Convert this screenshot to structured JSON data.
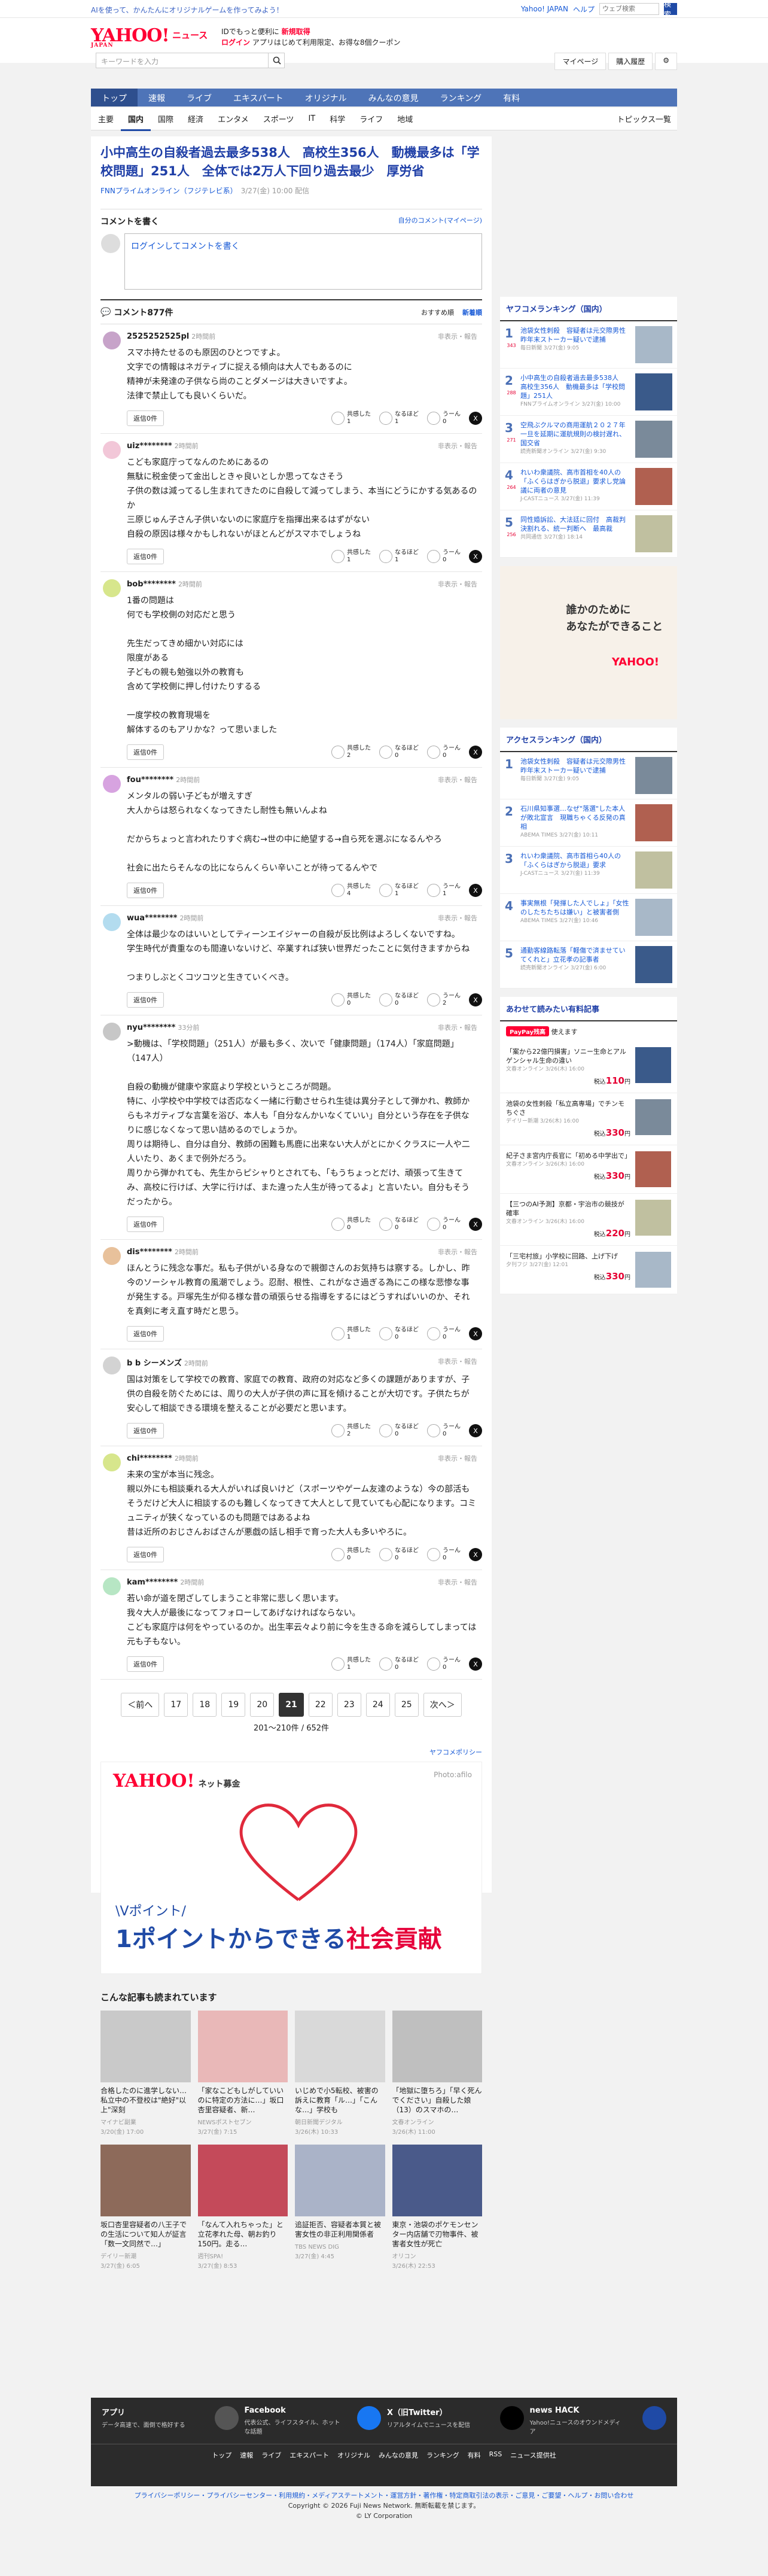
{
  "topstrip": {
    "promo": "AIを使って、かんたんにオリジナルゲームを作ってみよう！",
    "links": [
      "Yahoo! JAPAN",
      "ヘルプ"
    ],
    "search_placeholder": "ウェブ検索",
    "search_button": "検索"
  },
  "header": {
    "logo": "YAHOO!",
    "logo_sub": "JAPAN",
    "news": "ニュース",
    "promo_line1": "IDでもっと便利に",
    "promo_line1_b": "新規取得",
    "promo_line2_b": "ログイン",
    "promo_line2": "アプリはじめて利用限定、お得な8個クーポン",
    "search_placeholder": "キーワードを入力",
    "acct": [
      "マイページ",
      "購入履歴"
    ]
  },
  "gnav": [
    "トップ",
    "速報",
    "ライブ",
    "エキスパート",
    "オリジナル",
    "みんなの意見",
    "ランキング",
    "有料"
  ],
  "subnav": [
    "主要",
    "国内",
    "国際",
    "経済",
    "エンタメ",
    "スポーツ",
    "IT",
    "科学",
    "ライフ",
    "地域"
  ],
  "subnav_right": "トピックス一覧",
  "article": {
    "title": "小中高生の自殺者過去最多538人　高校生356人　動機最多は「学校問題」251人　全体では2万人下回り過去最少　厚労省",
    "source": "FNNプライムオンライン（フジテレビ系）",
    "date": "3/27(金) 10:00 配信"
  },
  "comment_box": {
    "heading": "コメントを書く",
    "mylink": "自分のコメント(マイページ)",
    "prompt": "ログインしてコメントを書く"
  },
  "comments_header": {
    "title": "コメント877件",
    "sort1": "おすすめ順",
    "sort2": "新着順"
  },
  "labels": {
    "report": "非表示・報告",
    "reply": "返信0件",
    "v1": "共感した",
    "v2": "なるほど",
    "v3": "うーん",
    "x": "X"
  },
  "comments": [
    {
      "user": "2525252525pl",
      "time": "2時間前",
      "text": "スマホ持たせるのも原因のひとつですよ。\n文字での情報はネガティブに捉える傾向は大人でもあるのに\n精神が未発達の子供なら尚のことダメージは大きいですよ。\n法律で禁止しても良いくらいだ。",
      "v": [
        "1",
        "1",
        "0"
      ],
      "color": "#c7a3c9"
    },
    {
      "user": "uiz********",
      "time": "2時間前",
      "text": "こども家庭庁ってなんのためにあるの\n無駄に税金使って金出しときゃ良いとしか思ってなさそう\n子供の数は減ってるし生まれてきたのに自殺して減ってしまう、本当にどうにかする気あるのか\n三原じゅん子さん子供いないのに家庭庁を指揮出来るはずがない\n自殺の原因は様々かもしれないがほとんどがスマホでしょうね",
      "v": [
        "1",
        "1",
        "0"
      ],
      "color": "#f2c7d8"
    },
    {
      "user": "bob********",
      "time": "2時間前",
      "text": "1番の問題は\n何でも学校側の対応だと思う\n\n先生だってきめ細かい対応には\n限度がある\n子どもの親も勉強以外の教育も\n含めて学校側に押し付けたりするる\n\n一度学校の教育現場を\n解体するのもアリかな？って思いました",
      "v": [
        "2",
        "0",
        "0"
      ],
      "color": "#d7e68c"
    },
    {
      "user": "fou********",
      "time": "2時間前",
      "text": "メンタルの弱い子どもが増えすぎ\n大人からは怒られなくなってきたし耐性も無いんよね\n\nだからちょっと言われたりすぐ病む→世の中に絶望する→自ら死を選ぶになるんやろ\n\n社会に出たらそんなの比にならんくらい辛いことが待ってるんやで",
      "v": [
        "4",
        "1",
        "1"
      ],
      "color": "#d7a3e0"
    },
    {
      "user": "wua********",
      "time": "2時間前",
      "text": "全体は最少なのはいいとしてティーンエイジャーの自殺が反比例はよろしくないですね。\n学生時代が貴重なのも間違いないけど、卒業すれば狭い世界だったことに気付きますからね\n\nつまりしぶとくコツコツと生きていくべき。",
      "v": [
        "0",
        "0",
        "2"
      ],
      "color": "#b3dcef"
    },
    {
      "user": "nyu********",
      "time": "33分前",
      "text": ">動機は、「学校問題」（251人）が最も多く、次いで「健康問題」（174人）「家庭問題」（147人）\n\n自殺の動機が健康や家庭より学校というところが問題。\n特に、小学校や中学校では否応なく一緒に行動させられ生徒は異分子として弾かれ、教師からもネガティブな言葉を浴び、本人も「自分なんかいなくていい」自分という存在を子供なりに感じなくなって思い詰めるのでしょうか。\n周りは期待し、自分は自分、教師の困難も馬鹿に出来ない大人がとにかくクラスに一人や二人いたり、あくまで例外だろう。\n周りから弾かれても、先生からピシャりとされても、「もうちょっとだけ、頑張って生きてみ、高校に行けば、大学に行けば、また違った人生が待ってるよ」と言いたい。自分もそうだったから。",
      "v": [
        "0",
        "0",
        "0"
      ],
      "color": "#c7c7c7"
    },
    {
      "user": "dis********",
      "time": "2時間前",
      "text": "ほんとうに残念な事だ。私も子供がいる身なので親御さんのお気持ちは察する。しかし、昨今のソーシャル教育の風潮でしょう。忍耐、根性、これがなさ過ぎる為にこの様な悲惨な事が発生する。戸塚先生が仰る様な昔の頑張らせる指導をするにはどうすればいいのか、それを真剣に考え直す時だと思う。",
      "v": [
        "1",
        "0",
        "0"
      ],
      "color": "#e8c19b"
    },
    {
      "user": "b b シーメンズ",
      "time": "2時間前",
      "text": "国は対策をして学校での教育、家庭での教育、政府の対応など多くの課題がありますが、子供の自殺を防ぐためには、周りの大人が子供の声に耳を傾けることが大切です。子供たちが安心して相談できる環境を整えることが必要だと思います。",
      "v": [
        "2",
        "0",
        "0"
      ],
      "color": "#d3d3d3"
    },
    {
      "user": "chi********",
      "time": "2時間前",
      "text": "未来の宝が本当に残念。\n親以外にも相談乗れる大人がいれば良いけど（スポーツやゲーム友達のような）今の部活もそうだけど大人に相談するのも難しくなってきて大人として見ていても心配になります。コミュニティが狭くなっているのも問題ではあるよね\n昔は近所のおじさんおばさんが悪戯の話し相手で育った大人も多いやろに。",
      "v": [
        "0",
        "0",
        "0"
      ],
      "color": "#d7e68c"
    },
    {
      "user": "kam********",
      "time": "2時間前",
      "text": "若い命が道を閉ざしてしまうこと非常に悲しく思います。\n我々大人が最後になってフォローしてあげなければならない。\nこども家庭庁は何をやっているのか。出生率云々より前に今を生きる命を減らしてしまっては元も子もない。",
      "v": [
        "1",
        "0",
        "0"
      ],
      "color": "#b7e6c4"
    }
  ],
  "pager": {
    "prev": "＜前へ",
    "pages": [
      "17",
      "18",
      "19",
      "20",
      "21",
      "22",
      "23",
      "24",
      "25"
    ],
    "current": "21",
    "next": "次へ＞",
    "info": "201〜210件 / 652件"
  },
  "yd_policy": "ヤフコメポリシー",
  "bigad": {
    "logo": "YAHOO!",
    "logo_sub": "ネット募金",
    "photo": "Photo:afilo",
    "t1": "\\Vポイント/",
    "t2a": "1ポイントからできる",
    "t2b": "社会貢献"
  },
  "related": {
    "heading": "こんな記事も読まれています",
    "items": [
      {
        "title": "合格したのに進学しない…私立中の不登校は\"絶好\"以上\"深刻",
        "src": "マイナビ副業",
        "time": "3/20(金) 17:00"
      },
      {
        "title": "「家なこどもしがしていいのに特定の方法に…」坂口杏里容疑者、新…",
        "src": "NEWSポストセブン",
        "time": "3/27(金) 7:15"
      },
      {
        "title": "いじめで小5転校、被害の訴えに教育「ル…」「こんな…」学校も",
        "src": "朝日新聞デジタル",
        "time": "3/26(木) 10:33"
      },
      {
        "title": "「地獄に堕ちろ」「早く死んでください」自殺した娘（13）のスマホの…",
        "src": "文春オンライン",
        "time": "3/26(木) 11:00"
      },
      {
        "title": "坂口杏里容疑者の八王子での生活について知人が証言「数一文同然で…」",
        "src": "デイリー新潮",
        "time": "3/27(金) 6:05"
      },
      {
        "title": "「なんて入れちゃった」と立花孝れた母、朝お釣り150円。走る…",
        "src": "週刊SPA!",
        "time": "3/27(金) 8:53"
      },
      {
        "title": "追証拒否、容疑者本質と被害女性の非正利用関係者",
        "src": "TBS NEWS DIG",
        "time": "3/27(金) 4:45"
      },
      {
        "title": "東京・池袋のポケモンセンター内店舗で刃物事件、被害者女性が死亡",
        "src": "オリコン",
        "time": "3/26(木) 22:53"
      }
    ]
  },
  "ranking": {
    "heading": "ヤフコメランキング（国内）",
    "items": [
      {
        "n": "1",
        "c": "343",
        "title": "池袋女性刺殺　容疑者は元交際男性　昨年末ストーカー疑いで逮捕",
        "src": "毎日新聞",
        "time": "3/27(金) 9:05"
      },
      {
        "n": "2",
        "c": "288",
        "title": "小中高生の自殺者過去最多538人　高校生356人　動機最多は「学校問題」251人",
        "src": "FNNプライムオンライン",
        "time": "3/27(金) 10:00"
      },
      {
        "n": "3",
        "c": "271",
        "title": "空飛ぶクルマの商用運航２０２７年一旦を延期に運航規則の検討遅れ、国交省",
        "src": "読売新聞オンライン",
        "time": "3/27(金) 9:30"
      },
      {
        "n": "4",
        "c": "264",
        "title": "れいわ衆議院、高市首相を40人の「ふくらはぎから脱退」要求し党論議に両者の意見",
        "src": "J-CASTニュース",
        "time": "3/27(金) 11:39"
      },
      {
        "n": "5",
        "c": "256",
        "title": "同性婚訴訟、大法廷に回付　高裁判決割れる、統一判断へ　最高裁",
        "src": "共同通信",
        "time": "3/27(金) 18:14"
      }
    ]
  },
  "side_ad": {
    "l1": "誰かのために",
    "l2": "あなたができること",
    "brand": "YAHOO!"
  },
  "access": {
    "heading": "アクセスランキング（国内）",
    "items": [
      {
        "n": "1",
        "title": "池袋女性刺殺　容疑者は元交際男性　昨年末ストーカー疑いで逮捕",
        "src": "毎日新聞",
        "time": "3/27(金) 9:05"
      },
      {
        "n": "2",
        "title": "石川県知事選…なぜ\"落選\"した本人が敗北宣言　現職ちゃくる反発の真相",
        "src": "ABEMA TIMES",
        "time": "3/27(金) 10:11"
      },
      {
        "n": "3",
        "title": "れいわ衆議院、高市首相ら40人の「ふくらはぎから脱退」要求",
        "src": "J-CASTニュース",
        "time": "3/27(金) 11:39"
      },
      {
        "n": "4",
        "title": "事実無根「発揮した人でしょ」「女性のしたちたちは嫌い」と被害者側",
        "src": "ABEMA TIMES",
        "time": "3/27(金) 10:46"
      },
      {
        "n": "5",
        "title": "通勤客線路転落「軽傷で済ませていてくれと」立花孝の記事者",
        "src": "読売新聞オンライン",
        "time": "3/27(金) 6:00"
      }
    ]
  },
  "paypay": {
    "heading": "あわせて読みたい有料記事",
    "label": "PayPay残高",
    "suffix": "使えます",
    "items": [
      {
        "title": "「案から22億円損害」ソニー生命とアルゲンシャル生命の違い",
        "src": "文春オンライン",
        "time": "3/26(木) 16:00",
        "price": "110"
      },
      {
        "title": "池袋の女性刺殺「私立高専場」でチンモちぐさ",
        "src": "デイリー新潮",
        "time": "3/26(木) 16:00",
        "price": "330"
      },
      {
        "title": "紀子さま宮内庁長官に「初める中学出で」",
        "src": "文春オンライン",
        "time": "3/26(木) 16:00",
        "price": "330"
      },
      {
        "title": "【三つのAI予測】京都・宇治市の競技が確率",
        "src": "文春オンライン",
        "time": "3/26(木) 16:00",
        "price": "220"
      },
      {
        "title": "「三宅村旅」小学校に回路、上げ下げ",
        "src": "夕刊フジ",
        "time": "3/27(金) 12:01",
        "price": "330"
      }
    ]
  },
  "footer": {
    "cols": [
      {
        "t": "アプリ",
        "d": "データ高速で、面倒で格好する"
      },
      {
        "t": "Facebook",
        "d": "代表公式、ライフスタイル、ホットな話題"
      },
      {
        "t": "X（旧Twitter）",
        "d": "リアルタイムでニュースを配信"
      },
      {
        "t": "news HACK",
        "d": "Yahoo!ニュースのオウンドメディア"
      }
    ],
    "links": [
      "トップ",
      "速報",
      "ライブ",
      "エキスパート",
      "オリジナル",
      "みんなの意見",
      "ランキング",
      "有料",
      "RSS",
      "ニュース提供社"
    ],
    "bottom1": "プライバシーポリシー・プライバシーセンター・利用規約・メディアステートメント・運営方針・著作権・特定商取引法の表示・ご意見・ご要望・ヘルプ・お問い合わせ",
    "copy1": "Copyright © 2026 Fuji News Network. 無断転載を禁じます。",
    "copy2": "© LY Corporation"
  }
}
